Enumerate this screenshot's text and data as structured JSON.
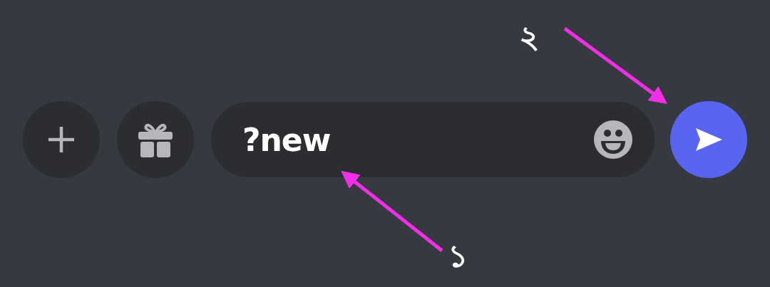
{
  "composer": {
    "attach_button": {
      "kind": "plus"
    },
    "gift_button": {
      "kind": "gift"
    },
    "message_field": {
      "value": "?new"
    },
    "emoji_button": {
      "kind": "emoji"
    },
    "send_button": {
      "kind": "send"
    }
  },
  "annotations": [
    {
      "label": "২"
    },
    {
      "label": "১"
    }
  ]
}
